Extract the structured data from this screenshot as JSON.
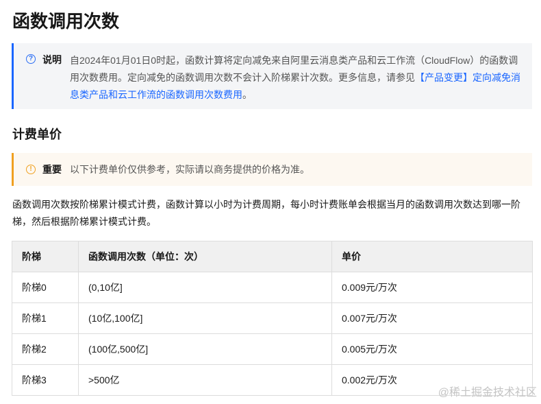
{
  "page_title": "函数调用次数",
  "note": {
    "icon": "question-circle-icon",
    "label": "说明",
    "text": "自2024年01月01日0时起，函数计算将定向减免来自阿里云消息类产品和云工作流（CloudFlow）的函数调用次数费用。定向减免的函数调用次数不会计入阶梯累计次数。更多信息，请参见",
    "link": "【产品变更】定向减免消息类产品和云工作流的函数调用次数费用",
    "end": "。"
  },
  "section_title": "计费单价",
  "important": {
    "icon": "exclamation-circle-icon",
    "label": "重要",
    "text": "以下计费单价仅供参考，实际请以商务提供的价格为准。"
  },
  "paragraph": "函数调用次数按阶梯累计模式计费，函数计算以小时为计费周期，每小时计费账单会根据当月的函数调用次数达到哪一阶梯，然后根据阶梯累计模式计费。",
  "table": {
    "headers": [
      "阶梯",
      "函数调用次数（单位：次）",
      "单价"
    ],
    "rows": [
      [
        "阶梯0",
        "(0,10亿]",
        "0.009元/万次"
      ],
      [
        "阶梯1",
        "(10亿,100亿]",
        "0.007元/万次"
      ],
      [
        "阶梯2",
        "(100亿,500亿]",
        "0.005元/万次"
      ],
      [
        "阶梯3",
        ">500亿",
        "0.002元/万次"
      ]
    ]
  },
  "watermark": "@稀土掘金技术社区",
  "colors": {
    "note_accent": "#1a66ff",
    "note_bg": "#f4f5f7",
    "important_accent": "#f0a020",
    "important_bg": "#fdf8f1",
    "table_header_bg": "#f0f0f0"
  }
}
